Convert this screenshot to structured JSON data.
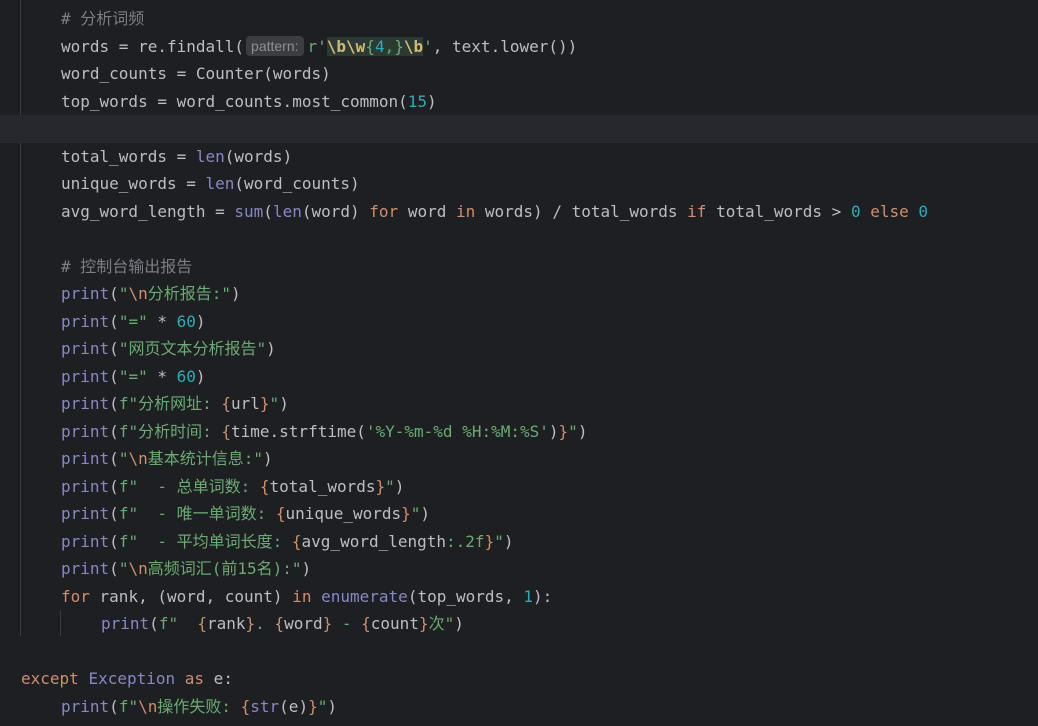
{
  "editor": {
    "parameter_hint": "pattern:",
    "lines": [
      {
        "indent": 1,
        "tokens": [
          {
            "t": "# 分析词频",
            "c": "comment"
          }
        ]
      },
      {
        "indent": 1,
        "tokens": [
          {
            "t": "words = re.findall(",
            "c": "plain"
          },
          {
            "hint": "pattern:"
          },
          {
            "t": "r'",
            "c": "string"
          },
          {
            "t": "\\b\\w",
            "c": "regexesc"
          },
          {
            "t": "{",
            "c": "regexbg"
          },
          {
            "t": "4",
            "c": "regexnum"
          },
          {
            "t": ",}",
            "c": "regexbg"
          },
          {
            "t": "\\b",
            "c": "regexesc"
          },
          {
            "t": "'",
            "c": "string"
          },
          {
            "t": ", text.lower())",
            "c": "plain"
          }
        ]
      },
      {
        "indent": 1,
        "tokens": [
          {
            "t": "word_counts = Counter(words)",
            "c": "plain"
          }
        ]
      },
      {
        "indent": 1,
        "tokens": [
          {
            "t": "top_words = word_counts.most_common(",
            "c": "plain"
          },
          {
            "t": "15",
            "c": "number"
          },
          {
            "t": ")",
            "c": "plain"
          }
        ]
      },
      {
        "indent": 0,
        "current": true,
        "tokens": []
      },
      {
        "indent": 1,
        "tokens": [
          {
            "t": "total_words = ",
            "c": "plain"
          },
          {
            "t": "len",
            "c": "builtin"
          },
          {
            "t": "(words)",
            "c": "plain"
          }
        ]
      },
      {
        "indent": 1,
        "tokens": [
          {
            "t": "unique_words = ",
            "c": "plain"
          },
          {
            "t": "len",
            "c": "builtin"
          },
          {
            "t": "(word_counts)",
            "c": "plain"
          }
        ]
      },
      {
        "indent": 1,
        "tokens": [
          {
            "t": "avg_word_length = ",
            "c": "plain"
          },
          {
            "t": "sum",
            "c": "builtin"
          },
          {
            "t": "(",
            "c": "plain"
          },
          {
            "t": "len",
            "c": "builtin"
          },
          {
            "t": "(word) ",
            "c": "plain"
          },
          {
            "t": "for",
            "c": "keyword"
          },
          {
            "t": " word ",
            "c": "plain"
          },
          {
            "t": "in",
            "c": "keyword"
          },
          {
            "t": " words) / total_words ",
            "c": "plain"
          },
          {
            "t": "if",
            "c": "keyword"
          },
          {
            "t": " total_words > ",
            "c": "plain"
          },
          {
            "t": "0",
            "c": "number"
          },
          {
            "t": " ",
            "c": "plain"
          },
          {
            "t": "else",
            "c": "keyword"
          },
          {
            "t": " ",
            "c": "plain"
          },
          {
            "t": "0",
            "c": "number"
          }
        ]
      },
      {
        "indent": 0,
        "tokens": []
      },
      {
        "indent": 1,
        "tokens": [
          {
            "t": "# 控制台输出报告",
            "c": "comment"
          }
        ]
      },
      {
        "indent": 1,
        "tokens": [
          {
            "t": "print",
            "c": "builtin"
          },
          {
            "t": "(",
            "c": "plain"
          },
          {
            "t": "\"",
            "c": "string"
          },
          {
            "t": "\\n",
            "c": "escape"
          },
          {
            "t": "分析报告:\"",
            "c": "string"
          },
          {
            "t": ")",
            "c": "plain"
          }
        ]
      },
      {
        "indent": 1,
        "tokens": [
          {
            "t": "print",
            "c": "builtin"
          },
          {
            "t": "(",
            "c": "plain"
          },
          {
            "t": "\"=\"",
            "c": "string"
          },
          {
            "t": " * ",
            "c": "plain"
          },
          {
            "t": "60",
            "c": "number"
          },
          {
            "t": ")",
            "c": "plain"
          }
        ]
      },
      {
        "indent": 1,
        "tokens": [
          {
            "t": "print",
            "c": "builtin"
          },
          {
            "t": "(",
            "c": "plain"
          },
          {
            "t": "\"网页文本分析报告\"",
            "c": "string"
          },
          {
            "t": ")",
            "c": "plain"
          }
        ]
      },
      {
        "indent": 1,
        "tokens": [
          {
            "t": "print",
            "c": "builtin"
          },
          {
            "t": "(",
            "c": "plain"
          },
          {
            "t": "\"=\"",
            "c": "string"
          },
          {
            "t": " * ",
            "c": "plain"
          },
          {
            "t": "60",
            "c": "number"
          },
          {
            "t": ")",
            "c": "plain"
          }
        ]
      },
      {
        "indent": 1,
        "tokens": [
          {
            "t": "print",
            "c": "builtin"
          },
          {
            "t": "(",
            "c": "plain"
          },
          {
            "t": "f\"分析网址: ",
            "c": "string"
          },
          {
            "t": "{",
            "c": "brace"
          },
          {
            "t": "url",
            "c": "plain"
          },
          {
            "t": "}",
            "c": "brace"
          },
          {
            "t": "\"",
            "c": "string"
          },
          {
            "t": ")",
            "c": "plain"
          }
        ]
      },
      {
        "indent": 1,
        "tokens": [
          {
            "t": "print",
            "c": "builtin"
          },
          {
            "t": "(",
            "c": "plain"
          },
          {
            "t": "f\"分析时间: ",
            "c": "string"
          },
          {
            "t": "{",
            "c": "brace"
          },
          {
            "t": "time.strftime(",
            "c": "plain"
          },
          {
            "t": "'%Y-%m-%d %H:%M:%S'",
            "c": "string"
          },
          {
            "t": ")",
            "c": "plain"
          },
          {
            "t": "}",
            "c": "brace"
          },
          {
            "t": "\"",
            "c": "string"
          },
          {
            "t": ")",
            "c": "plain"
          }
        ]
      },
      {
        "indent": 1,
        "tokens": [
          {
            "t": "print",
            "c": "builtin"
          },
          {
            "t": "(",
            "c": "plain"
          },
          {
            "t": "\"",
            "c": "string"
          },
          {
            "t": "\\n",
            "c": "escape"
          },
          {
            "t": "基本统计信息:\"",
            "c": "string"
          },
          {
            "t": ")",
            "c": "plain"
          }
        ]
      },
      {
        "indent": 1,
        "tokens": [
          {
            "t": "print",
            "c": "builtin"
          },
          {
            "t": "(",
            "c": "plain"
          },
          {
            "t": "f\"  - 总单词数: ",
            "c": "string"
          },
          {
            "t": "{",
            "c": "brace"
          },
          {
            "t": "total_words",
            "c": "plain"
          },
          {
            "t": "}",
            "c": "brace"
          },
          {
            "t": "\"",
            "c": "string"
          },
          {
            "t": ")",
            "c": "plain"
          }
        ]
      },
      {
        "indent": 1,
        "tokens": [
          {
            "t": "print",
            "c": "builtin"
          },
          {
            "t": "(",
            "c": "plain"
          },
          {
            "t": "f\"  - 唯一单词数: ",
            "c": "string"
          },
          {
            "t": "{",
            "c": "brace"
          },
          {
            "t": "unique_words",
            "c": "plain"
          },
          {
            "t": "}",
            "c": "brace"
          },
          {
            "t": "\"",
            "c": "string"
          },
          {
            "t": ")",
            "c": "plain"
          }
        ]
      },
      {
        "indent": 1,
        "tokens": [
          {
            "t": "print",
            "c": "builtin"
          },
          {
            "t": "(",
            "c": "plain"
          },
          {
            "t": "f\"  - 平均单词长度: ",
            "c": "string"
          },
          {
            "t": "{",
            "c": "brace"
          },
          {
            "t": "avg_word_length",
            "c": "plain"
          },
          {
            "t": ":.2f",
            "c": "string"
          },
          {
            "t": "}",
            "c": "brace"
          },
          {
            "t": "\"",
            "c": "string"
          },
          {
            "t": ")",
            "c": "plain"
          }
        ]
      },
      {
        "indent": 1,
        "tokens": [
          {
            "t": "print",
            "c": "builtin"
          },
          {
            "t": "(",
            "c": "plain"
          },
          {
            "t": "\"",
            "c": "string"
          },
          {
            "t": "\\n",
            "c": "escape"
          },
          {
            "t": "高频词汇(前15名):\"",
            "c": "string"
          },
          {
            "t": ")",
            "c": "plain"
          }
        ]
      },
      {
        "indent": 1,
        "tokens": [
          {
            "t": "for",
            "c": "keyword"
          },
          {
            "t": " rank, (word, count) ",
            "c": "plain"
          },
          {
            "t": "in",
            "c": "keyword"
          },
          {
            "t": " ",
            "c": "plain"
          },
          {
            "t": "enumerate",
            "c": "builtin"
          },
          {
            "t": "(top_words, ",
            "c": "plain"
          },
          {
            "t": "1",
            "c": "number"
          },
          {
            "t": "):",
            "c": "plain"
          }
        ]
      },
      {
        "indent": 2,
        "tokens": [
          {
            "t": "print",
            "c": "builtin"
          },
          {
            "t": "(",
            "c": "plain"
          },
          {
            "t": "f\"  ",
            "c": "string"
          },
          {
            "t": "{",
            "c": "brace"
          },
          {
            "t": "rank",
            "c": "plain"
          },
          {
            "t": "}",
            "c": "brace"
          },
          {
            "t": ". ",
            "c": "string"
          },
          {
            "t": "{",
            "c": "brace"
          },
          {
            "t": "word",
            "c": "plain"
          },
          {
            "t": "}",
            "c": "brace"
          },
          {
            "t": " - ",
            "c": "string"
          },
          {
            "t": "{",
            "c": "brace"
          },
          {
            "t": "count",
            "c": "plain"
          },
          {
            "t": "}",
            "c": "brace"
          },
          {
            "t": "次\"",
            "c": "string"
          },
          {
            "t": ")",
            "c": "plain"
          }
        ]
      },
      {
        "indent": 0,
        "tokens": []
      },
      {
        "indent": 0,
        "tokens": [
          {
            "t": "except",
            "c": "keyword"
          },
          {
            "t": " ",
            "c": "plain"
          },
          {
            "t": "Exception",
            "c": "exc"
          },
          {
            "t": " ",
            "c": "plain"
          },
          {
            "t": "as",
            "c": "keyword"
          },
          {
            "t": " e:",
            "c": "plain"
          }
        ]
      },
      {
        "indent": 1,
        "tokens": [
          {
            "t": "print",
            "c": "builtin"
          },
          {
            "t": "(",
            "c": "plain"
          },
          {
            "t": "f\"",
            "c": "string"
          },
          {
            "t": "\\n",
            "c": "escape"
          },
          {
            "t": "操作失败: ",
            "c": "string"
          },
          {
            "t": "{",
            "c": "brace"
          },
          {
            "t": "str",
            "c": "builtin"
          },
          {
            "t": "(e)",
            "c": "plain"
          },
          {
            "t": "}",
            "c": "brace"
          },
          {
            "t": "\"",
            "c": "string"
          },
          {
            "t": ")",
            "c": "plain"
          }
        ]
      }
    ]
  }
}
